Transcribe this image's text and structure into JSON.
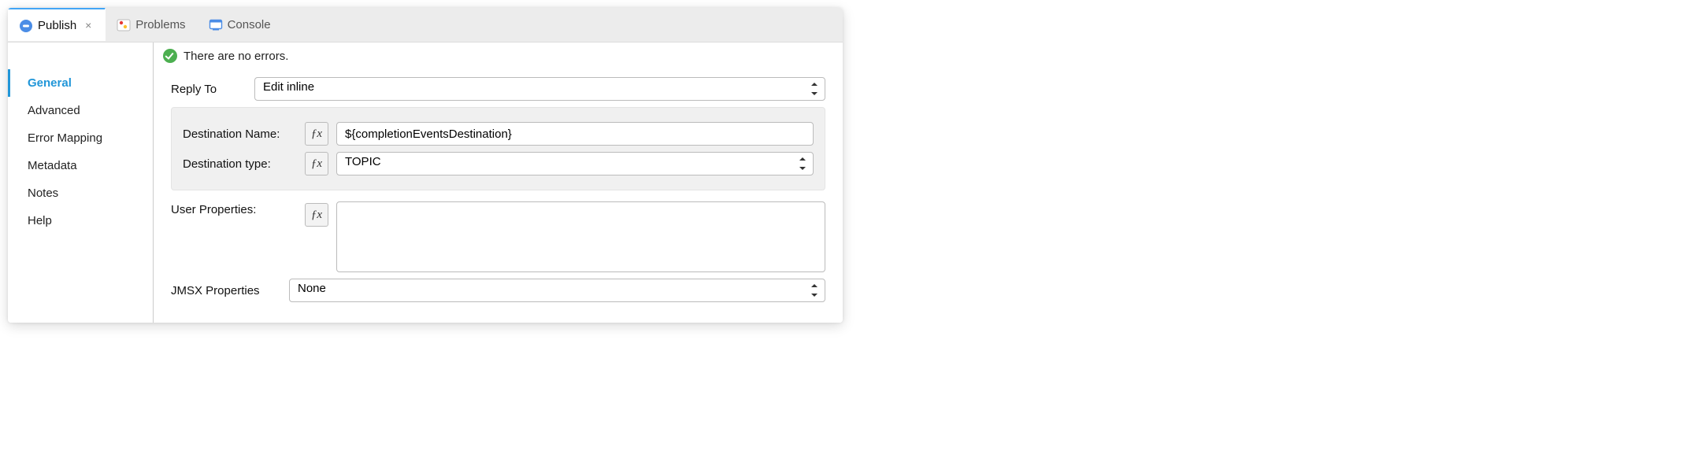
{
  "tabs": {
    "publish": {
      "label": "Publish"
    },
    "problems": {
      "label": "Problems"
    },
    "console": {
      "label": "Console"
    }
  },
  "sidebar": {
    "items": [
      {
        "label": "General"
      },
      {
        "label": "Advanced"
      },
      {
        "label": "Error Mapping"
      },
      {
        "label": "Metadata"
      },
      {
        "label": "Notes"
      },
      {
        "label": "Help"
      }
    ]
  },
  "status": {
    "message": "There are no errors."
  },
  "form": {
    "reply_to": {
      "label": "Reply To",
      "value": "Edit inline"
    },
    "destination_name": {
      "label": "Destination Name:",
      "value": "${completionEventsDestination}"
    },
    "destination_type": {
      "label": "Destination type:",
      "value": "TOPIC"
    },
    "user_properties": {
      "label": "User Properties:",
      "value": ""
    },
    "jmsx_properties": {
      "label": "JMSX Properties",
      "value": "None"
    },
    "fx_label": "ƒx"
  }
}
